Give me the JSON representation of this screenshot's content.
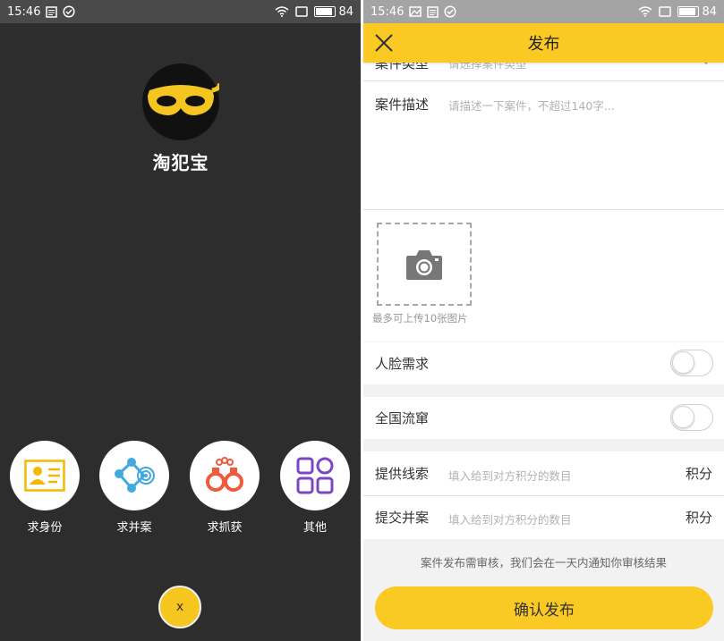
{
  "left_screen": {
    "status_bar": {
      "time": "15:46",
      "battery": "84"
    },
    "app_name": "淘犯宝",
    "menu_items": [
      {
        "label": "求身份",
        "icon": "id-card-icon"
      },
      {
        "label": "求并案",
        "icon": "network-link-icon"
      },
      {
        "label": "求抓获",
        "icon": "handcuffs-icon"
      },
      {
        "label": "其他",
        "icon": "grid-apps-icon"
      }
    ],
    "close_label": "x"
  },
  "right_screen": {
    "status_bar": {
      "time": "15:46",
      "battery": "84"
    },
    "header_title": "发布",
    "case_type": {
      "label": "案件类型",
      "placeholder": "请选择案件类型"
    },
    "case_desc": {
      "label": "案件描述",
      "placeholder": "请描述一下案件，不超过140字..."
    },
    "upload_hint": "最多可上传10张图片",
    "face_request": {
      "label": "人脸需求",
      "on": false
    },
    "nationwide": {
      "label": "全国流窜",
      "on": false
    },
    "provide_clue": {
      "label": "提供线索",
      "placeholder": "填入给到对方积分的数目",
      "unit": "积分"
    },
    "submit_merge": {
      "label": "提交并案",
      "placeholder": "填入给到对方积分的数目",
      "unit": "积分"
    },
    "notice": "案件发布需审核，我们会在一天内通知你审核结果",
    "confirm_label": "确认发布"
  },
  "colors": {
    "accent": "#fbc923",
    "dark_bg": "#2d2d2d"
  }
}
